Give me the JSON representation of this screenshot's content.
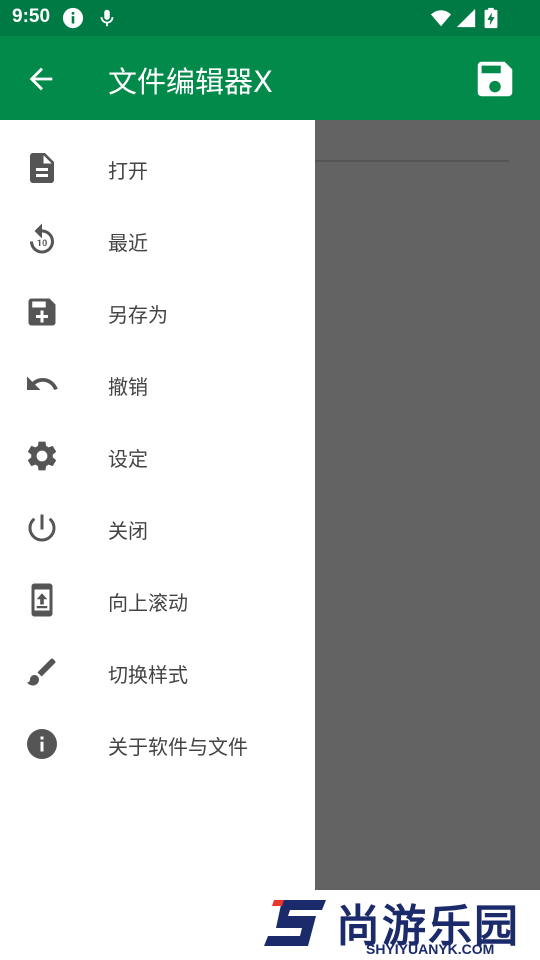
{
  "status_bar": {
    "time": "9:50",
    "icons": [
      "info-icon",
      "mic-icon",
      "wifi-icon",
      "signal-icon",
      "battery-charging-icon"
    ]
  },
  "app_bar": {
    "title": "文件编辑器X",
    "back_icon": "arrow-back-icon",
    "save_icon": "save-icon"
  },
  "drawer": {
    "items": [
      {
        "label": "打开",
        "icon": "file-icon"
      },
      {
        "label": "最近",
        "icon": "replay-10-icon"
      },
      {
        "label": "另存为",
        "icon": "save-plus-icon"
      },
      {
        "label": "撤销",
        "icon": "undo-icon"
      },
      {
        "label": "设定",
        "icon": "gear-icon"
      },
      {
        "label": "关闭",
        "icon": "power-icon"
      },
      {
        "label": "向上滚动",
        "icon": "phone-scroll-up-icon"
      },
      {
        "label": "切换样式",
        "icon": "brush-icon"
      },
      {
        "label": "关于软件与文件",
        "icon": "info-icon"
      }
    ]
  },
  "watermark": {
    "brand": "尚游乐园",
    "url": "SHYIYUANYK.COM"
  },
  "colors": {
    "status_bar": "#007a44",
    "app_bar": "#028a4b",
    "scrim": "#636363",
    "icon": "#555555",
    "label": "#444444"
  }
}
